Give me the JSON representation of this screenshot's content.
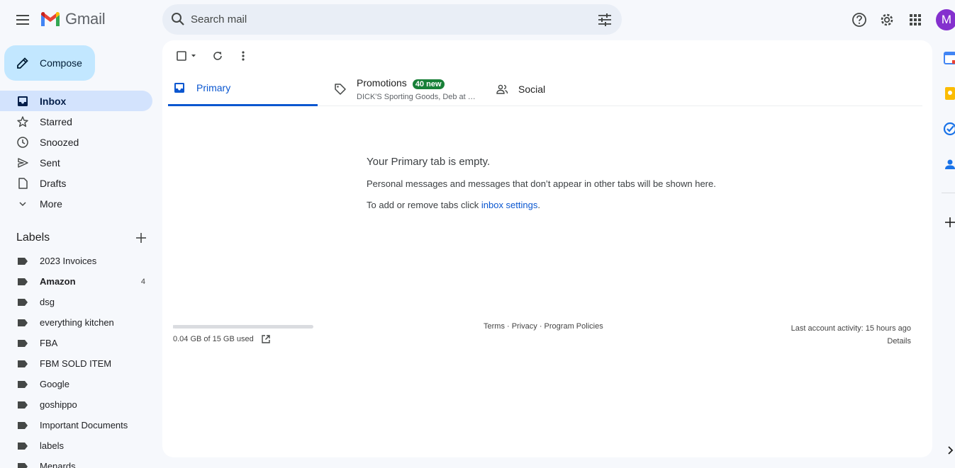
{
  "app": {
    "name": "Gmail"
  },
  "search": {
    "placeholder": "Search mail"
  },
  "avatar": {
    "initial": "M",
    "color": "#8430ce"
  },
  "compose": {
    "label": "Compose"
  },
  "nav": [
    {
      "label": "Inbox",
      "icon": "inbox-icon",
      "active": true
    },
    {
      "label": "Starred",
      "icon": "star-icon"
    },
    {
      "label": "Snoozed",
      "icon": "clock-icon"
    },
    {
      "label": "Sent",
      "icon": "send-icon"
    },
    {
      "label": "Drafts",
      "icon": "draft-icon"
    },
    {
      "label": "More",
      "icon": "chevron-down-icon"
    }
  ],
  "labels": {
    "title": "Labels",
    "items": [
      {
        "label": "2023 Invoices"
      },
      {
        "label": "Amazon",
        "count": "4",
        "bold": true
      },
      {
        "label": "dsg"
      },
      {
        "label": "everything kitchen"
      },
      {
        "label": "FBA"
      },
      {
        "label": "FBM SOLD ITEM"
      },
      {
        "label": "Google"
      },
      {
        "label": "goshippo"
      },
      {
        "label": "Important Documents"
      },
      {
        "label": "labels"
      },
      {
        "label": "Menards"
      }
    ]
  },
  "tabs": {
    "primary": "Primary",
    "promotions": "Promotions",
    "promotions_badge": "40 new",
    "promotions_sub": "DICK'S Sporting Goods, Deb at …",
    "social": "Social"
  },
  "empty": {
    "title": "Your Primary tab is empty.",
    "line1": "Personal messages and messages that don’t appear in other tabs will be shown here.",
    "line2_prefix": "To add or remove tabs click ",
    "line2_link": "inbox settings",
    "line2_suffix": "."
  },
  "footer": {
    "storage": "0.04 GB of 15 GB used",
    "storage_fraction": 0.003,
    "links": "Terms · Privacy · Program Policies",
    "activity": "Last account activity: 15 hours ago",
    "details": "Details"
  },
  "colors": {
    "accent": "#0b57d0",
    "active_nav": "#d3e3fd",
    "compose_bg": "#c2e7ff",
    "badge": "#188038"
  }
}
